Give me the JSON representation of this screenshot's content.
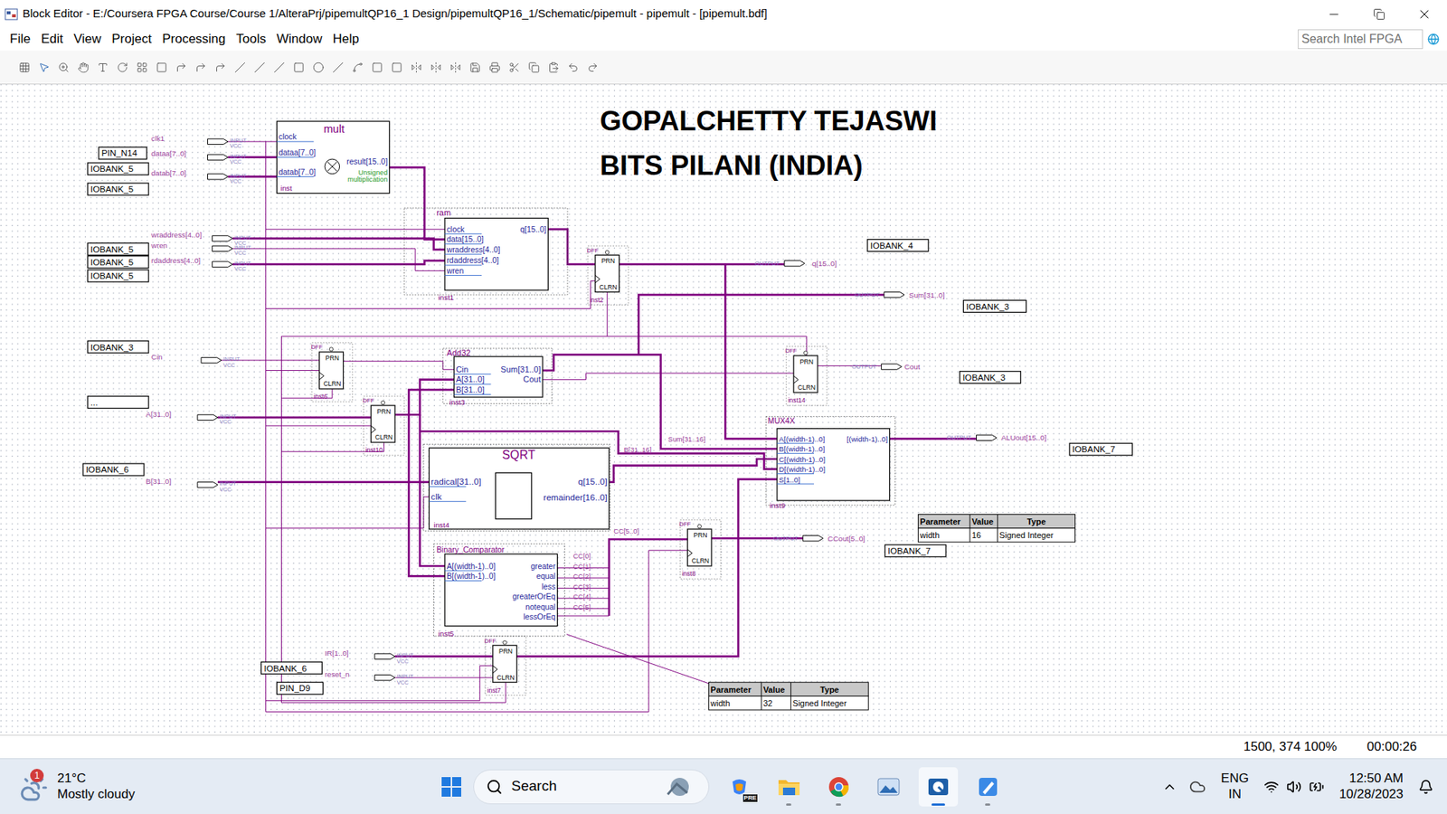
{
  "window": {
    "title": "Block Editor - E:/Coursera FPGA Course/Course 1/AlteraPrj/pipemultQP16_1 Design/pipemultQP16_1/Schematic/pipemult - pipemult - [pipemult.bdf]"
  },
  "menu": [
    "File",
    "Edit",
    "View",
    "Project",
    "Processing",
    "Tools",
    "Window",
    "Help"
  ],
  "search": {
    "placeholder": "Search Intel FPGA"
  },
  "heading": [
    "GOPALCHETTY TEJASWI",
    "BITS PILANI (INDIA)"
  ],
  "blocks": [
    {
      "title": "mult",
      "inst": "inst",
      "left": [
        "clock",
        "dataa[7..0]",
        "datab[7..0]"
      ],
      "right": [
        "result[15..0]"
      ],
      "notes": [
        "Unsigned",
        "multiplication"
      ]
    },
    {
      "title": "ram",
      "inst": "inst1",
      "left": [
        "clock",
        "data[15..0]",
        "wraddress[4..0]",
        "rdaddress[4..0]",
        "wren"
      ],
      "right": [
        "q[15..0]"
      ],
      "notes": []
    },
    {
      "title": "Add32",
      "inst": "inst3",
      "left": [
        "Cin",
        "A[31..0]",
        "B[31..0]"
      ],
      "right": [
        "Sum[31..0]",
        "Cout"
      ],
      "notes": []
    },
    {
      "title": "SQRT",
      "inst": "inst4",
      "left": [
        "radical[31..0]",
        "clk"
      ],
      "right": [
        "q[15..0]",
        "remainder[16..0]"
      ],
      "notes": []
    },
    {
      "title": "Binary_Comparator",
      "inst": "inst5",
      "left": [
        "A[(width-1)..0]",
        "B[(width-1)..0]"
      ],
      "right": [
        "greater",
        "equal",
        "less",
        "greaterOrEq",
        "notequal",
        "lessOrEq"
      ],
      "notes": []
    },
    {
      "title": "MUX4X",
      "inst": "inst9",
      "left": [
        "A[(width-1)..0]",
        "B[(width-1)..0]",
        "C[(width-1)..0]",
        "D[(width-1)..0]",
        "S[1..0]"
      ],
      "right": [
        "[(width-1)..0]"
      ],
      "notes": []
    }
  ],
  "dff": {
    "type": "DFF",
    "prn": "PRN",
    "clrn": "CLRN",
    "insts": [
      "inst2",
      "inst6",
      "inst10",
      "inst14",
      "inst8",
      "inst7"
    ]
  },
  "inputs": {
    "kind": "INPUT",
    "vcc": "VCC",
    "pins": [
      "clk1",
      "dataa[7..0]",
      "datab[7..0]",
      "wraddress[4..0]",
      "wren",
      "rdaddress[4..0]",
      "Cin",
      "A[31..0]",
      "B[31..0]",
      "IR[1..0]",
      "reset_n"
    ]
  },
  "outputs": {
    "kind": "OUTPUT",
    "pins": [
      "q[15..0]",
      "Sum[31..0]",
      "Cout",
      "ALUout[15..0]",
      "CCout[5..0]"
    ]
  },
  "locations": [
    "PIN_N14",
    "IOBANK_5",
    "IOBANK_5",
    "IOBANK_5",
    "IOBANK_5",
    "IOBANK_5",
    "IOBANK_3",
    "...",
    "IOBANK_6",
    "IOBANK_6",
    "PIN_D9",
    "IOBANK_4",
    "IOBANK_3",
    "IOBANK_3",
    "IOBANK_7",
    "IOBANK_7"
  ],
  "wire_labels": [
    "Sum[31..16]",
    "B[31..16]",
    "CC[5..0]",
    "CC[0]",
    "CC[1]",
    "CC[2]",
    "CC[3]",
    "CC[4]",
    "CC[5]"
  ],
  "param_headers": [
    "Parameter",
    "Value",
    "Type"
  ],
  "params": [
    [
      "width",
      "16",
      "Signed Integer"
    ],
    [
      "width",
      "32",
      "Signed Integer"
    ]
  ],
  "status_bar": {
    "coords": "1500, 374 100%",
    "time": "00:00:26"
  },
  "taskbar": {
    "weather": {
      "temp": "21°C",
      "desc": "Mostly cloudy",
      "badge": "1"
    },
    "search": "Search",
    "copilot_badge": "PRE",
    "apps": [
      {
        "name": "copilot",
        "running": false,
        "selected": false
      },
      {
        "name": "files",
        "running": true,
        "selected": false
      },
      {
        "name": "chrome",
        "running": true,
        "selected": false
      },
      {
        "name": "photos",
        "running": false,
        "selected": false
      },
      {
        "name": "quartus",
        "running": true,
        "selected": true
      },
      {
        "name": "paint",
        "running": true,
        "selected": false
      }
    ],
    "lang": [
      "ENG",
      "IN"
    ],
    "time": "12:50 AM",
    "date": "10/28/2023"
  }
}
